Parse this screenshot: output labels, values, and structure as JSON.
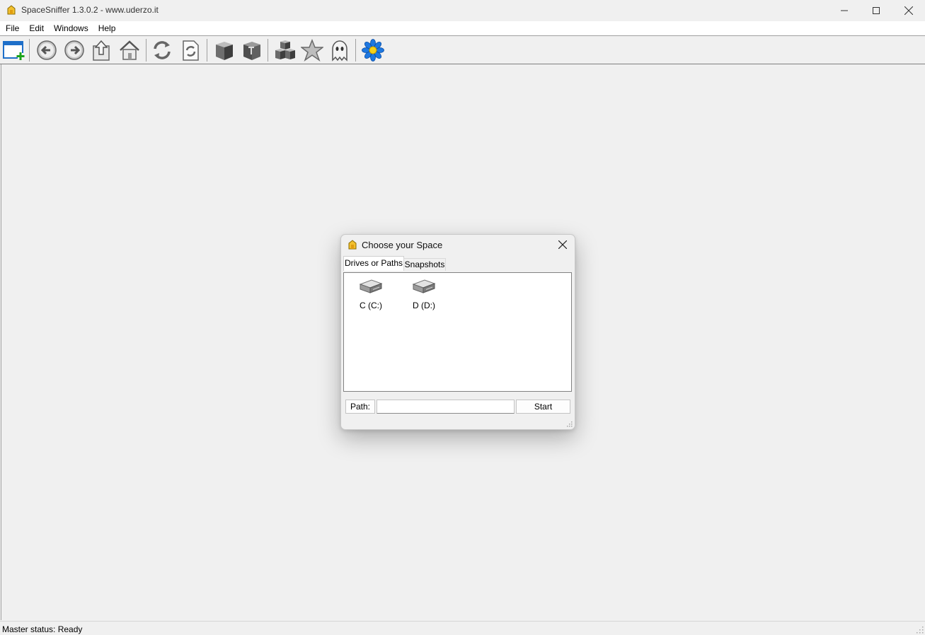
{
  "window": {
    "title": "SpaceSniffer 1.3.0.2 - www.uderzo.it"
  },
  "menu": [
    "File",
    "Edit",
    "Windows",
    "Help"
  ],
  "toolbar": {
    "buttons": [
      "new-window-icon",
      "back-icon",
      "forward-icon",
      "up-folder-icon",
      "home-icon",
      "refresh-icon",
      "refresh-file-icon",
      "cube-icon",
      "cube-highlight-icon",
      "cubes-icon",
      "star-icon",
      "ghost-icon",
      "flower-icon"
    ]
  },
  "dialog": {
    "title": "Choose your Space",
    "tabs": [
      "Drives or Paths",
      "Snapshots"
    ],
    "drives": [
      {
        "label": "C (C:)"
      },
      {
        "label": "D (D:)"
      }
    ],
    "path_label": "Path:",
    "path_value": "",
    "start_label": "Start"
  },
  "status": {
    "text": "Master status: Ready"
  }
}
